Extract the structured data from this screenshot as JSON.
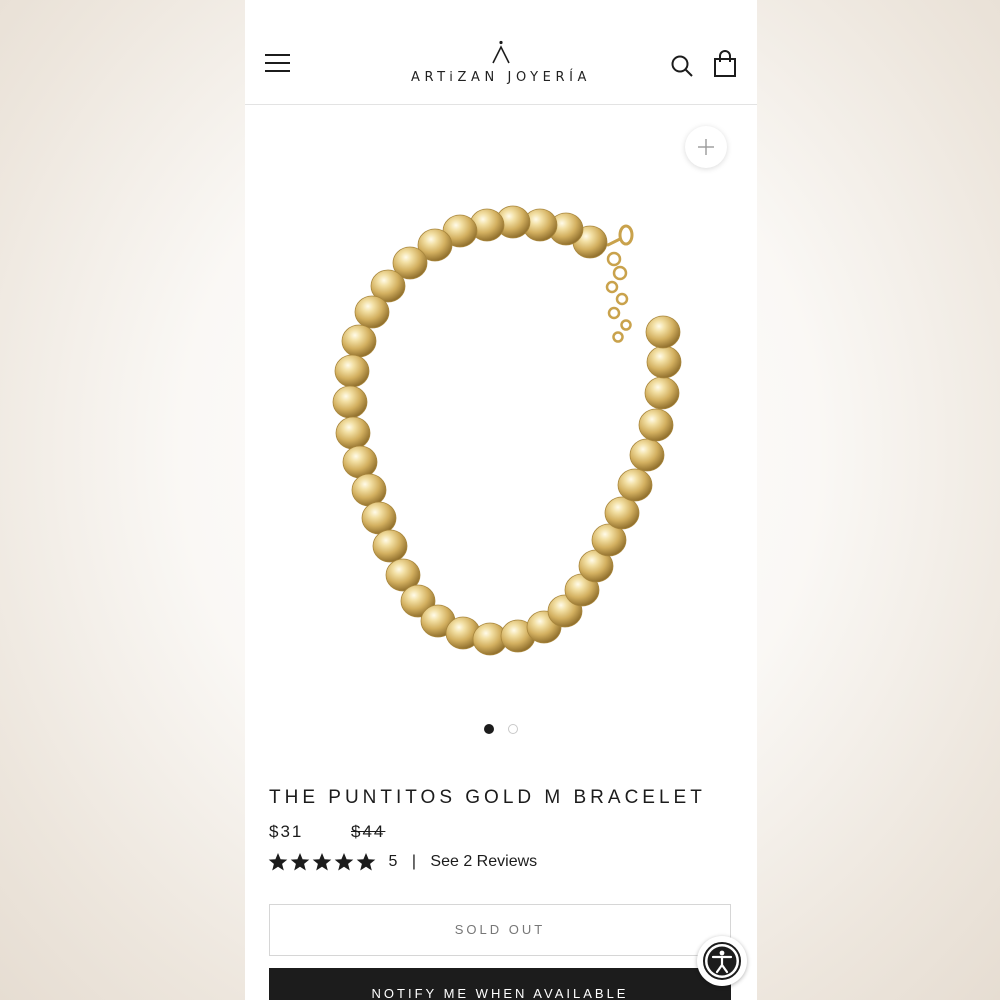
{
  "header": {
    "logo_text": "ARTiZAN JOYERÍA",
    "menu_icon": "hamburger-menu-icon",
    "search_icon": "search-icon",
    "cart_icon": "shopping-bag-icon"
  },
  "gallery": {
    "zoom_icon": "plus-icon",
    "image_subject": "gold bead bracelet",
    "slide_count": 2,
    "active_slide": 1
  },
  "product": {
    "title": "THE PUNTITOS GOLD M BRACELET",
    "price": "$31",
    "compare_at_price": "$44",
    "rating_stars": 5,
    "rating_value": "5",
    "separator": "|",
    "reviews_link": "See 2 Reviews"
  },
  "buttons": {
    "sold_out_label": "SOLD OUT",
    "notify_label": "NOTIFY ME WHEN AVAILABLE"
  },
  "accessibility": {
    "icon": "accessibility-icon"
  },
  "colors": {
    "text": "#1c1c1c",
    "gold": "#d8b868",
    "notify_button_bg": "#1c1c1c"
  }
}
